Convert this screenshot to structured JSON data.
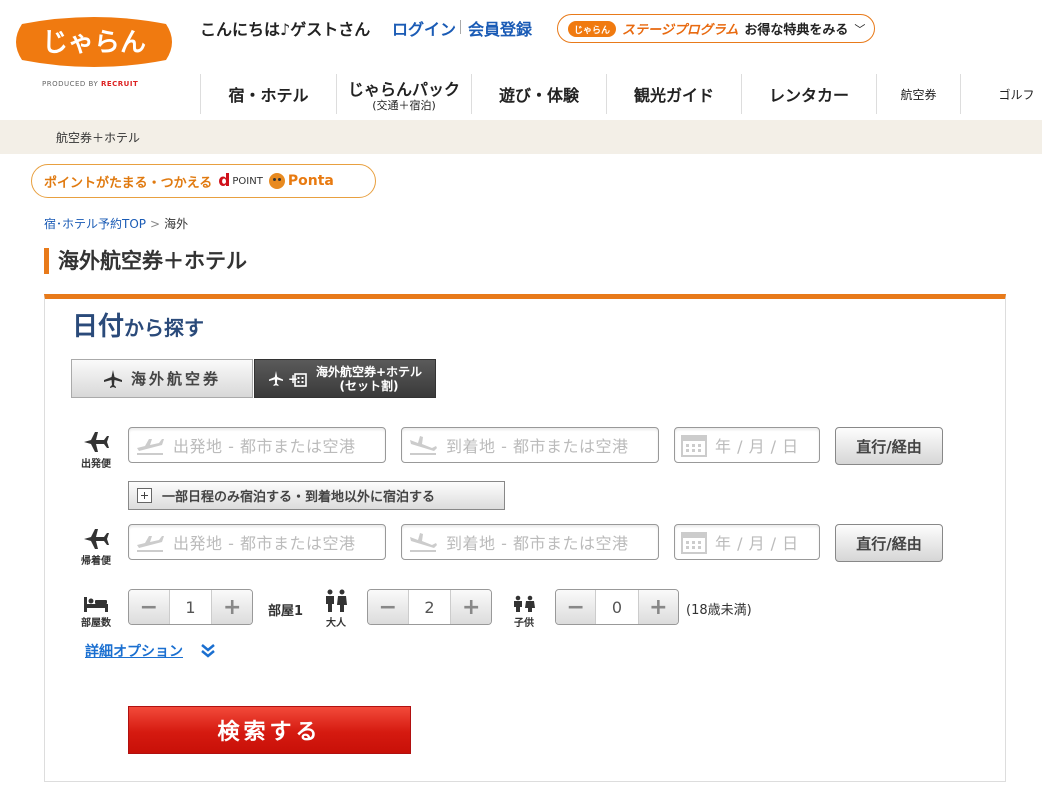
{
  "header": {
    "greeting": "こんにちは♪ゲストさん",
    "login": "ログイン",
    "register": "会員登録",
    "logo_text": "じゃらん",
    "produced_by": "PRODUCED BY",
    "recruit": "RECRUIT",
    "stage_logo_text": "じゃらん",
    "stage_program": "ステージプログラム",
    "stage_link": "お得な特典をみる"
  },
  "nav": {
    "items": [
      {
        "label": "宿・ホテル",
        "sub": ""
      },
      {
        "label": "じゃらんパック",
        "sub": "(交通＋宿泊)"
      },
      {
        "label": "遊び・体験",
        "sub": ""
      },
      {
        "label": "観光ガイド",
        "sub": ""
      },
      {
        "label": "レンタカー",
        "sub": ""
      },
      {
        "label": "航空券",
        "sub": ""
      },
      {
        "label": "ゴルフ",
        "sub": ""
      }
    ]
  },
  "breadcrumb_bar": "航空券＋ホテル",
  "points_banner": {
    "label": "ポイントがたまる・つかえる",
    "dpoint_mark": "d",
    "dpoint": "POINT",
    "ponta": "Ponta"
  },
  "breadcrumbs": {
    "top": "宿･ホテル予約TOP",
    "sep": ">",
    "current": "海外"
  },
  "page_title": "海外航空券＋ホテル",
  "search": {
    "title_big": "日付",
    "title_small": "から探す",
    "tab_flight": "海外航空券",
    "tab_set_line1": "海外航空券+ホテル",
    "tab_set_line2": "(セット割)",
    "outbound_label": "出発便",
    "return_label": "帰着便",
    "origin_placeholder": "出発地 - 都市または空港",
    "destination_placeholder": "到着地 - 都市または空港",
    "date_placeholder": "年 / 月 / 日",
    "direct_via": "直行/経由",
    "stopover": "一部日程のみ宿泊する・到着地以外に宿泊する",
    "rooms_label": "部屋数",
    "rooms_value": "1",
    "room_name": "部屋1",
    "adults_label": "大人",
    "adults_value": "2",
    "children_label": "子供",
    "children_value": "0",
    "children_note": "(18歳未満)",
    "detail_options": "詳細オプション",
    "submit": "検索する",
    "minus": "−",
    "plus": "+"
  },
  "colors": {
    "brand_orange": "#e87a1a",
    "link_blue": "#1a5bb5",
    "title_navy": "#2a4a7a",
    "search_red": "#d51a10"
  }
}
